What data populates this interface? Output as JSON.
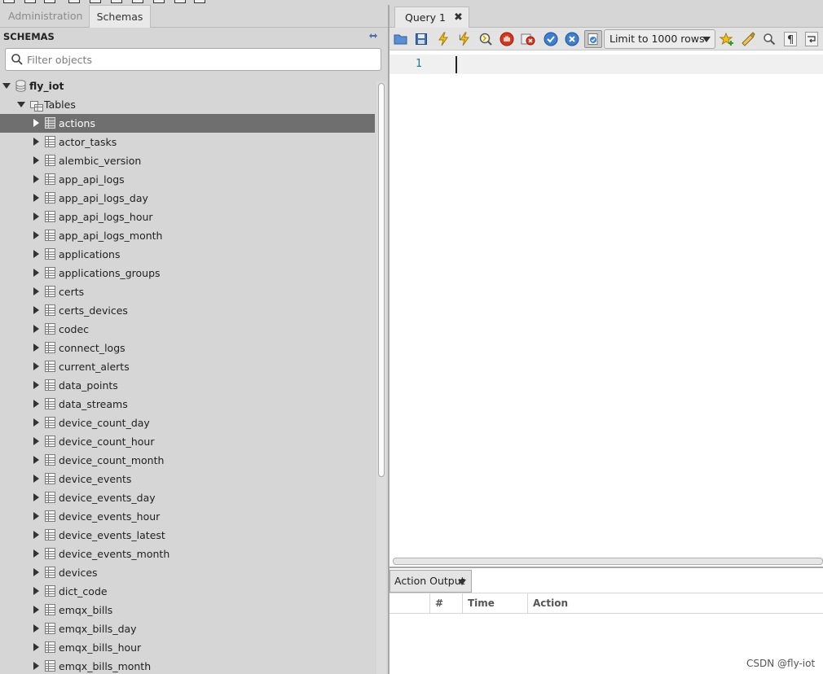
{
  "left_panel": {
    "tabs": {
      "administration": "Administration",
      "schemas": "Schemas"
    },
    "section_title": "SCHEMAS",
    "filter_placeholder": "Filter objects",
    "tree": {
      "schema": "fly_iot",
      "folder": "Tables",
      "selected_table": "actions",
      "tables": [
        "actions",
        "actor_tasks",
        "alembic_version",
        "app_api_logs",
        "app_api_logs_day",
        "app_api_logs_hour",
        "app_api_logs_month",
        "applications",
        "applications_groups",
        "certs",
        "certs_devices",
        "codec",
        "connect_logs",
        "current_alerts",
        "data_points",
        "data_streams",
        "device_count_day",
        "device_count_hour",
        "device_count_month",
        "device_events",
        "device_events_day",
        "device_events_hour",
        "device_events_latest",
        "device_events_month",
        "devices",
        "dict_code",
        "emqx_bills",
        "emqx_bills_day",
        "emqx_bills_hour",
        "emqx_bills_month"
      ]
    }
  },
  "query_panel": {
    "tab_label": "Query 1",
    "tab_close": "✖",
    "limit_select": "Limit to 1000 rows",
    "editor": {
      "line_number": "1",
      "content": ""
    }
  },
  "output": {
    "selector": "Action Output",
    "columns": [
      "#",
      "Time",
      "Action"
    ]
  },
  "watermark": "CSDN @fly-iot",
  "colors": {
    "selected_row": "#6f6f6f",
    "line_number": "#1a7a8a",
    "panel_bg": "#d6d6d6"
  }
}
